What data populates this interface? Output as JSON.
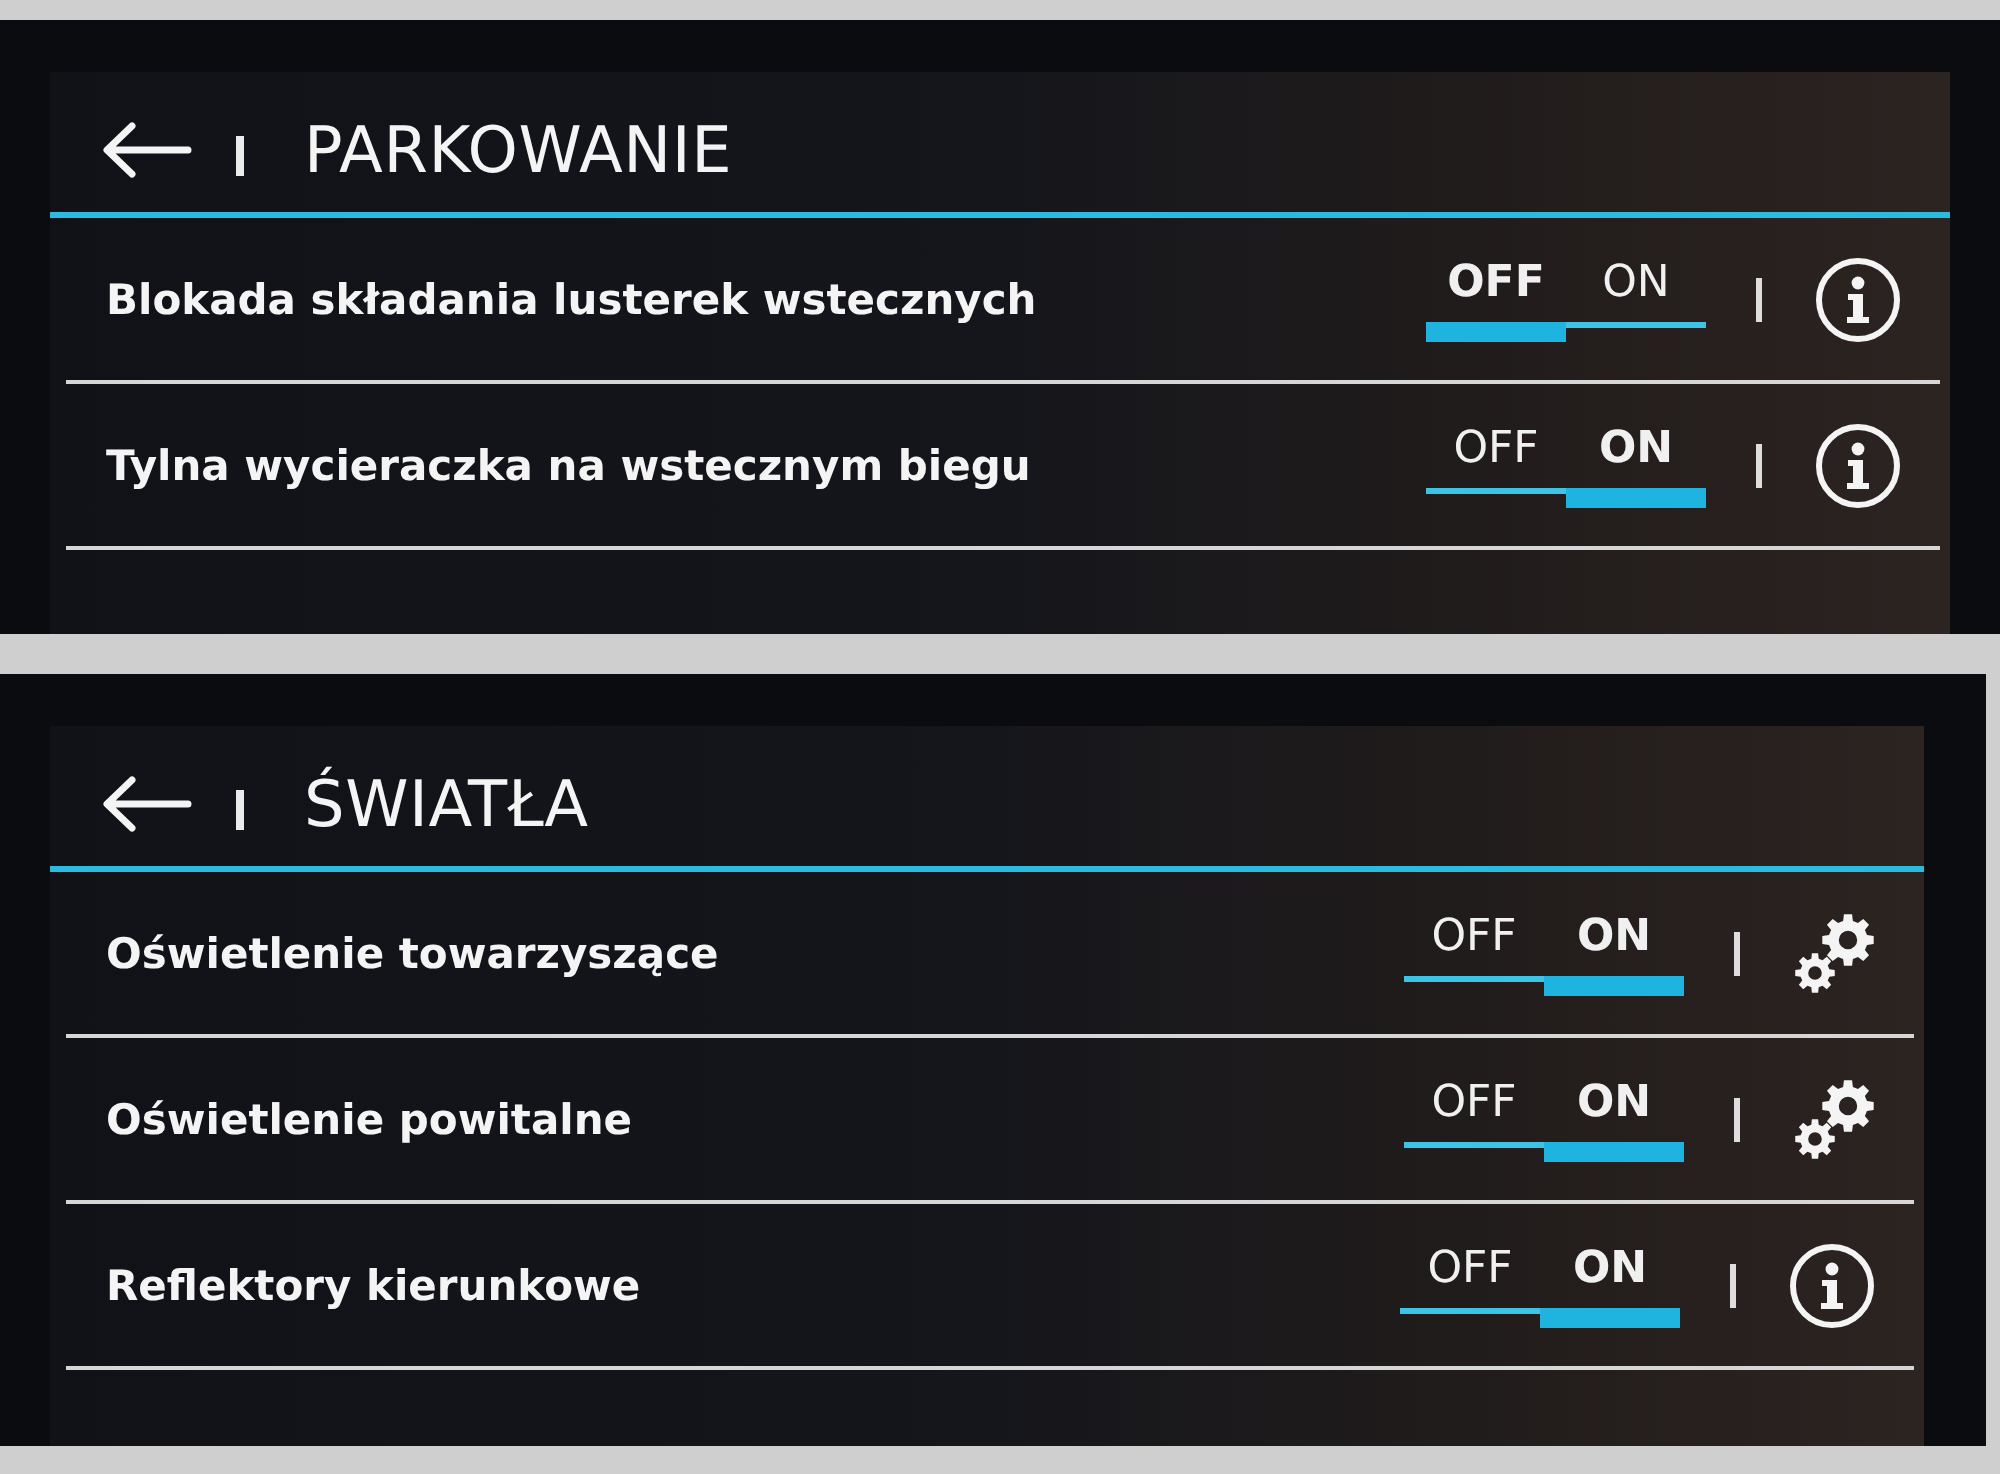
{
  "screens": [
    {
      "title": "PARKOWANIE",
      "rows": [
        {
          "label": "Blokada składania lusterek wstecznych",
          "kind": "info",
          "options": [
            {
              "label": "OFF",
              "selected": true
            },
            {
              "label": "ON",
              "selected": false
            }
          ]
        },
        {
          "label": "Tylna wycieraczka na wstecznym biegu",
          "kind": "info",
          "options": [
            {
              "label": "OFF",
              "selected": false
            },
            {
              "label": "ON",
              "selected": true
            }
          ]
        }
      ]
    },
    {
      "title": "ŚWIATŁA",
      "rows": [
        {
          "label": "Oświetlenie towarzyszące",
          "kind": "settings",
          "options": [
            {
              "label": "OFF",
              "selected": false
            },
            {
              "label": "ON",
              "selected": true
            }
          ]
        },
        {
          "label": "Oświetlenie powitalne",
          "kind": "settings",
          "options": [
            {
              "label": "OFF",
              "selected": false
            },
            {
              "label": "ON",
              "selected": true
            }
          ]
        },
        {
          "label": "Reflektory kierunkowe",
          "kind": "info",
          "options": [
            {
              "label": "OFF",
              "selected": false
            },
            {
              "label": "ON",
              "selected": true
            }
          ]
        }
      ]
    }
  ]
}
